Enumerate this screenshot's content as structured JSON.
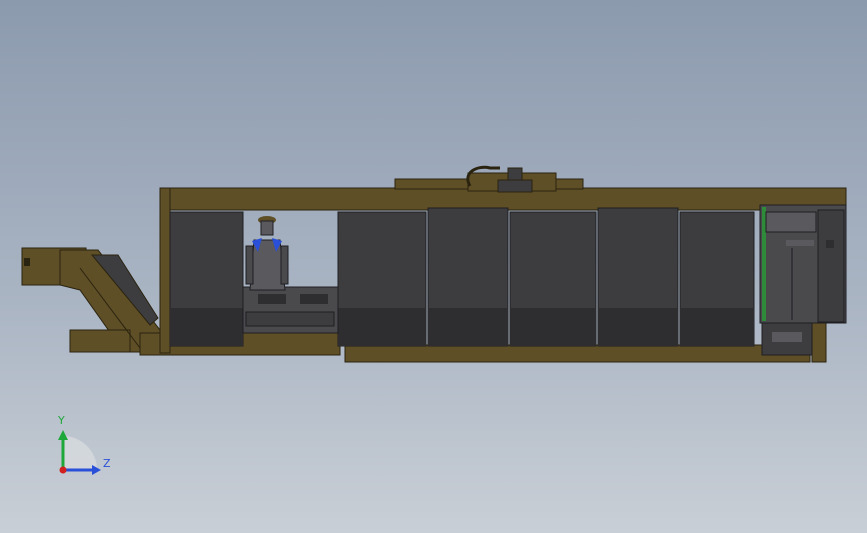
{
  "viewport": {
    "background_top": "#8c9aae",
    "background_bottom": "#c9cfd6"
  },
  "model": {
    "frame_color": "#5f4f26",
    "frame_edge": "#2a230f",
    "panel_color": "#3d3d40",
    "panel_lower_color": "#2e2e31",
    "cabinet_color": "#4a4a4d",
    "accent_green": "#2e8b3a"
  },
  "triad": {
    "y_label": "Y",
    "z_label": "Z",
    "y_color": "#1fa83a",
    "z_color": "#2a4fd8",
    "x_color": "#d02020"
  }
}
